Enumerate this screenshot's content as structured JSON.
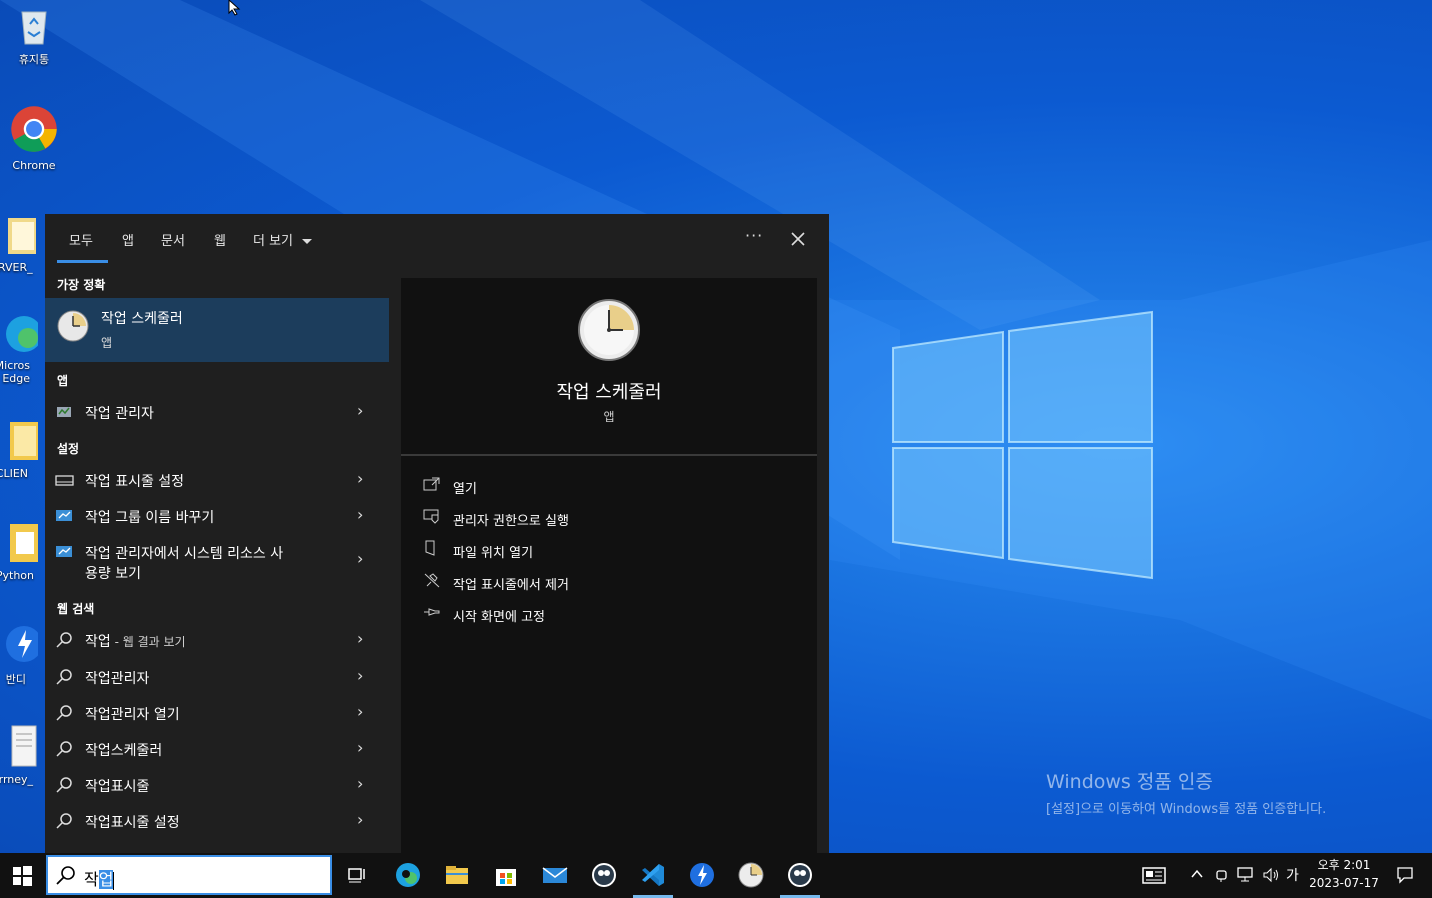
{
  "desktop": {
    "icons": [
      {
        "label": "휴지통"
      },
      {
        "label": "Chrome"
      },
      {
        "label": "SERVER_"
      },
      {
        "label": "Micros Edge"
      },
      {
        "label": "CLIEN"
      },
      {
        "label": "Python"
      },
      {
        "label": "반디"
      },
      {
        "label": "Currney_"
      }
    ],
    "watermark": {
      "line1": "Windows 정품 인증",
      "line2": "[설정]으로 이동하여 Windows를 정품 인증합니다."
    }
  },
  "search_panel": {
    "tabs": [
      "모두",
      "앱",
      "문서",
      "웹",
      "더 보기"
    ],
    "active_tab": "모두",
    "best_match": {
      "header": "가장 정확",
      "title": "작업 스케줄러",
      "type": "앱"
    },
    "apps": {
      "header": "앱",
      "items": [
        {
          "label": "작업 관리자"
        }
      ]
    },
    "settings": {
      "header": "설정",
      "items": [
        {
          "label": "작업 표시줄 설정"
        },
        {
          "label": "작업 그룹 이름 바꾸기"
        },
        {
          "label": "작업 관리자에서 시스템 리소스 사",
          "label2": "용량 보기"
        }
      ]
    },
    "web": {
      "header": "웹 검색",
      "first": {
        "label": "작업",
        "suffix": " - 웹 결과 보기"
      },
      "items": [
        {
          "label": "작업관리자"
        },
        {
          "label": "작업관리자 열기"
        },
        {
          "label": "작업스케줄러"
        },
        {
          "label": "작업표시줄"
        },
        {
          "label": "작업표시줄 설정"
        }
      ]
    },
    "preview": {
      "title": "작업 스케줄러",
      "type": "앱",
      "actions": [
        {
          "label": "열기",
          "icon": "open-icon"
        },
        {
          "label": "관리자 권한으로 실행",
          "icon": "shield-icon"
        },
        {
          "label": "파일 위치 열기",
          "icon": "file-location-icon"
        },
        {
          "label": "작업 표시줄에서 제거",
          "icon": "unpin-icon"
        },
        {
          "label": "시작 화면에 고정",
          "icon": "pin-icon"
        }
      ]
    }
  },
  "taskbar": {
    "search_text_before": "작",
    "search_text_selected": "업",
    "ime": "가",
    "time": "오후 2:01",
    "date": "2023-07-17"
  },
  "colors": {
    "accent": "#3a8ee6",
    "best_match_bg": "#1c3d5c",
    "panel_bg": "#1f1f1f",
    "preview_bg": "#111111"
  }
}
